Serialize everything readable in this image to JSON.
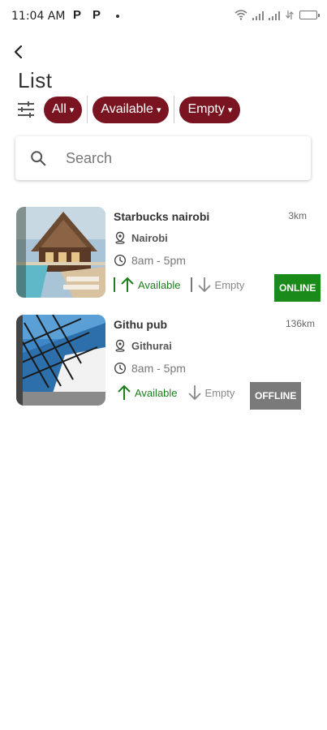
{
  "status_bar": {
    "time": "11:04 AM",
    "notif_1": "P",
    "notif_2": "P"
  },
  "header": {
    "title": "List"
  },
  "filters": {
    "chips": [
      {
        "label": "All"
      },
      {
        "label": "Available"
      },
      {
        "label": "Empty"
      }
    ],
    "caret": "▾"
  },
  "search": {
    "placeholder": "Search",
    "value": ""
  },
  "places": [
    {
      "name": "Starbucks nairobi",
      "distance": "3km",
      "location": "Nairobi",
      "hours": "8am - 5pm",
      "available_label": "Available",
      "empty_label": "Empty",
      "status": "ONLINE",
      "status_color": "#1a8a1a"
    },
    {
      "name": "Githu pub",
      "distance": "136km",
      "location": "Githurai",
      "hours": "8am - 5pm",
      "available_label": "Available",
      "empty_label": "Empty",
      "status": "OFFLINE",
      "status_color": "#7a7a7a"
    }
  ],
  "colors": {
    "chip_bg": "#7a1420",
    "available": "#1e7d1e"
  }
}
